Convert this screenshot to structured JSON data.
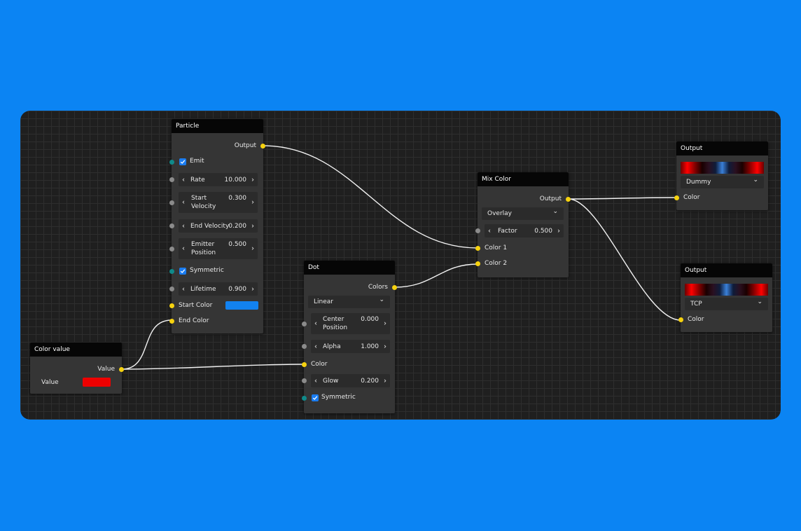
{
  "colors": {
    "background": "#0B84F3",
    "canvas": "#1f1f1f",
    "node": "#353535",
    "header": "#060606",
    "port_yellow": "#f6d20f",
    "port_gray": "#8b8b8b",
    "port_teal": "#0f8a8a",
    "checkbox": "#1a7cf0"
  },
  "particle": {
    "title": "Particle",
    "output": "Output",
    "emit": "Emit",
    "rate": {
      "label": "Rate",
      "value": "10.000"
    },
    "start_velocity": {
      "label": "Start\nVelocity",
      "value": "0.300"
    },
    "end_velocity": {
      "label": "End Velocity",
      "value": "0.200"
    },
    "emitter_position": {
      "label": "Emitter\nPosition",
      "value": "0.500"
    },
    "symmetric": "Symmetric",
    "lifetime": {
      "label": "Lifetime",
      "value": "0.900"
    },
    "start_color": "Start Color",
    "start_color_value": "#1282f0",
    "end_color": "End Color"
  },
  "color_value": {
    "title": "Color value",
    "output": "Value",
    "label": "Value",
    "swatch": "#ee0000"
  },
  "dot": {
    "title": "Dot",
    "output": "Colors",
    "mode": "Linear",
    "center_position": {
      "label": "Center\nPosition",
      "value": "0.000"
    },
    "alpha": {
      "label": "Alpha",
      "value": "1.000"
    },
    "color": "Color",
    "glow": {
      "label": "Glow",
      "value": "0.200"
    },
    "symmetric": "Symmetric"
  },
  "mix_color": {
    "title": "Mix Color",
    "output": "Output",
    "mode": "Overlay",
    "factor": {
      "label": "Factor",
      "value": "0.500"
    },
    "color1": "Color 1",
    "color2": "Color 2"
  },
  "output1": {
    "title": "Output",
    "device": "Dummy",
    "color": "Color"
  },
  "output2": {
    "title": "Output",
    "device": "TCP",
    "color": "Color"
  },
  "icons": {
    "chevron_left": "‹",
    "chevron_right": "›",
    "chevron_down": "⌄"
  }
}
